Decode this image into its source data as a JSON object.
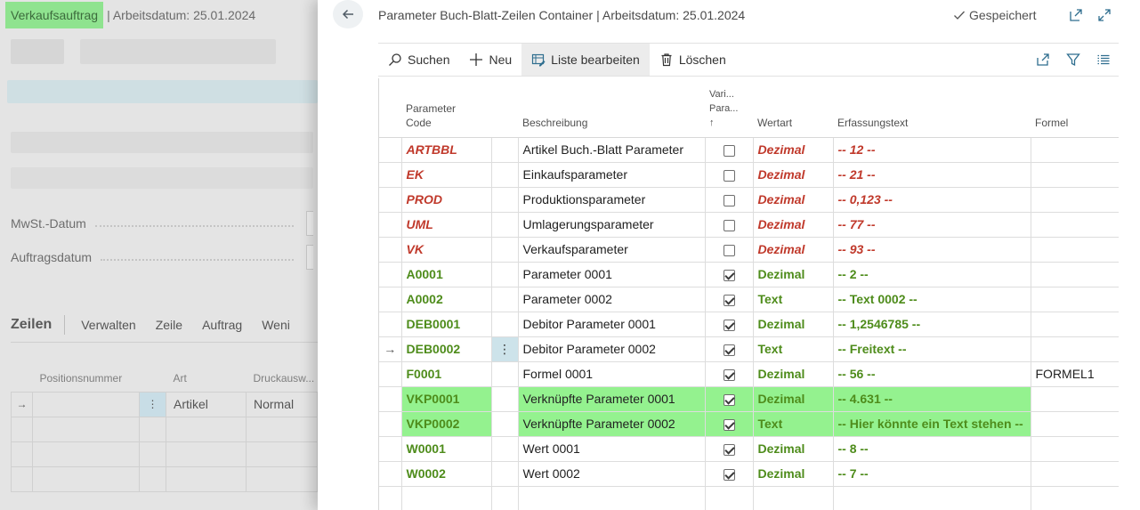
{
  "background_page": {
    "title_highlight": "Verkaufsauftrag",
    "title_rest": "| Arbeitsdatum: 25.01.2024",
    "fields": [
      {
        "label": "MwSt.-Datum"
      },
      {
        "label": "Auftragsdatum"
      }
    ],
    "lines_section": {
      "title": "Zeilen",
      "actions": [
        "Verwalten",
        "Zeile",
        "Auftrag",
        "Weni"
      ]
    },
    "grid": {
      "columns": [
        "Positionsnummer",
        "Art",
        "Druckausw..."
      ],
      "first_row": {
        "art": "Artikel",
        "druck": "Normal"
      }
    }
  },
  "dialog": {
    "title": "Parameter Buch-Blatt-Zeilen Container | Arbeitsdatum: 25.01.2024",
    "saved_label": "Gespeichert",
    "toolbar": {
      "search_label": "Suchen",
      "new_label": "Neu",
      "edit_list_label": "Liste bearbeiten",
      "delete_label": "Löschen"
    },
    "columns": {
      "code_line1": "Parameter",
      "code_line2": "Code",
      "description": "Beschreibung",
      "variable_line1": "Vari...",
      "variable_line2": "Para...",
      "variable_sort": "↑",
      "type": "Wertart",
      "entry_text": "Erfassungstext",
      "formula": "Formel"
    },
    "rows": [
      {
        "code": "ARTBBL",
        "description": "Artikel Buch.-Blatt Parameter",
        "checked": false,
        "type": "Dezimal",
        "entry": "-- 12 --",
        "formula": "",
        "style": "red"
      },
      {
        "code": "EK",
        "description": "Einkaufsparameter",
        "checked": false,
        "type": "Dezimal",
        "entry": "-- 21 --",
        "formula": "",
        "style": "red"
      },
      {
        "code": "PROD",
        "description": "Produktionsparameter",
        "checked": false,
        "type": "Dezimal",
        "entry": "-- 0,123 --",
        "formula": "",
        "style": "red"
      },
      {
        "code": "UML",
        "description": "Umlagerungsparameter",
        "checked": false,
        "type": "Dezimal",
        "entry": "-- 77 --",
        "formula": "",
        "style": "red"
      },
      {
        "code": "VK",
        "description": "Verkaufsparameter",
        "checked": false,
        "type": "Dezimal",
        "entry": "-- 93 --",
        "formula": "",
        "style": "red"
      },
      {
        "code": "A0001",
        "description": "Parameter 0001",
        "checked": true,
        "type": "Dezimal",
        "entry": "-- 2 --",
        "formula": "",
        "style": "green"
      },
      {
        "code": "A0002",
        "description": "Parameter 0002",
        "checked": true,
        "type": "Text",
        "entry": "-- Text 0002 --",
        "formula": "",
        "style": "green"
      },
      {
        "code": "DEB0001",
        "description": "Debitor Parameter 0001",
        "checked": true,
        "type": "Dezimal",
        "entry": "-- 1,2546785 --",
        "formula": "",
        "style": "green"
      },
      {
        "code": "DEB0002",
        "description": "Debitor Parameter 0002",
        "checked": true,
        "type": "Text",
        "entry": "-- Freitext --",
        "formula": "",
        "style": "green",
        "current": true
      },
      {
        "code": "F0001",
        "description": "Formel 0001",
        "checked": true,
        "type": "Dezimal",
        "entry": "-- 56 --",
        "formula": "FORMEL1",
        "style": "green"
      },
      {
        "code": "VKP0001",
        "description": "Verknüpfte Parameter 0001",
        "checked": true,
        "type": "Dezimal",
        "entry": "-- 4.631 --",
        "formula": "",
        "style": "green",
        "highlight": true
      },
      {
        "code": "VKP0002",
        "description": "Verknüpfte Parameter 0002",
        "checked": true,
        "type": "Text",
        "entry": "-- Hier könnte ein Text stehen --",
        "formula": "",
        "style": "green",
        "highlight": true
      },
      {
        "code": "W0001",
        "description": "Wert 0001",
        "checked": true,
        "type": "Dezimal",
        "entry": "-- 8 --",
        "formula": "",
        "style": "green"
      },
      {
        "code": "W0002",
        "description": "Wert 0002",
        "checked": true,
        "type": "Dezimal",
        "entry": "-- 7 --",
        "formula": "",
        "style": "green"
      }
    ]
  },
  "icons": {
    "back": "arrow-left-icon",
    "saved": "checkmark-icon",
    "open_new_window": "open-in-new-window-icon",
    "expand": "expand-icon",
    "search": "search-icon",
    "new": "plus-icon",
    "edit_list": "edit-list-icon",
    "delete": "trash-icon",
    "share": "share-icon",
    "filter": "filter-icon",
    "list_view": "list-view-icon"
  },
  "colors": {
    "red_text": "#c0392b",
    "green_text": "#4e8c1b",
    "row_highlight": "#94f28f",
    "accent": "#2f6e8f"
  }
}
